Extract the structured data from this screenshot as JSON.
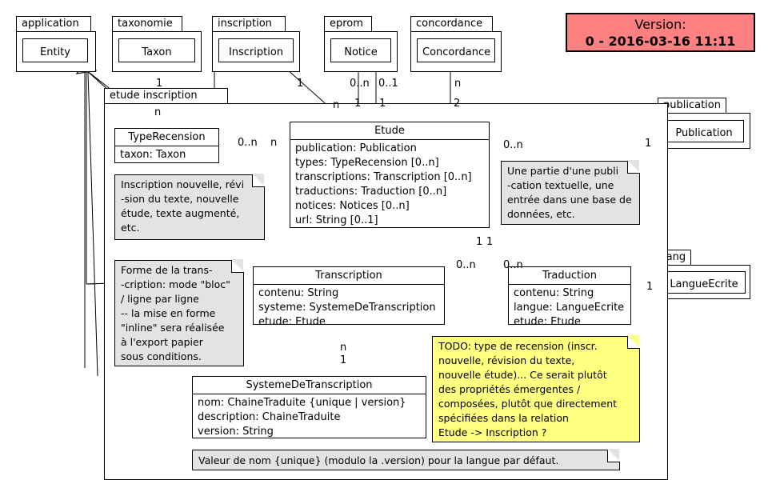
{
  "version_banner": {
    "label": "Version:",
    "value": "0 - 2016-03-16 11:11",
    "bg_color": "#fd8181",
    "border_color": "#000000"
  },
  "packages": [
    {
      "name": "application"
    },
    {
      "name": "taxonomie"
    },
    {
      "name": "inscription"
    },
    {
      "name": "eprom"
    },
    {
      "name": "concordance"
    },
    {
      "name": "publication"
    },
    {
      "name": "etude inscription"
    },
    {
      "name": "lang"
    }
  ],
  "classes": [
    {
      "name": "Entity",
      "attributes": []
    },
    {
      "name": "Taxon",
      "attributes": []
    },
    {
      "name": "Inscription",
      "attributes": []
    },
    {
      "name": "Notice",
      "attributes": []
    },
    {
      "name": "Concordance",
      "attributes": []
    },
    {
      "name": "Publication",
      "attributes": []
    },
    {
      "name": "LangueEcrite",
      "attributes": []
    },
    {
      "name": "TypeRecension",
      "attributes": [
        "taxon: Taxon"
      ]
    },
    {
      "name": "Etude",
      "attributes": [
        "publication: Publication",
        "types: TypeRecension [0..n]",
        "transcriptions: Transcription [0..n]",
        "traductions: Traduction [0..n]",
        "notices: Notices [0..n]",
        "url: String [0..1]"
      ]
    },
    {
      "name": "Transcription",
      "attributes": [
        "contenu: String",
        "systeme: SystemeDeTranscription",
        "etude: Etude"
      ]
    },
    {
      "name": "Traduction",
      "attributes": [
        "contenu: String",
        "langue: LangueEcrite",
        "etude: Etude"
      ]
    },
    {
      "name": "SystemeDeTranscription",
      "attributes": [
        "nom: ChaineTraduite {unique | version}",
        "description: ChaineTraduite",
        "version: String"
      ]
    }
  ],
  "notes": [
    {
      "id": "note-typerecension",
      "color": "#e3e3e3",
      "lines": [
        "Inscription nouvelle, révi",
        "-sion du texte, nouvelle",
        "étude, texte augmenté,",
        "etc."
      ]
    },
    {
      "id": "note-publication",
      "color": "#e3e3e3",
      "lines": [
        "Une partie d'une publi",
        "-cation textuelle, une",
        "entrée dans une base de",
        "données, etc."
      ]
    },
    {
      "id": "note-transcription",
      "color": "#e3e3e3",
      "lines": [
        "Forme de la trans-",
        "-cription: mode \"bloc\"",
        "/ ligne par ligne",
        "-- la mise en forme",
        "\"inline\" sera réalisée",
        "à l'export papier",
        "sous conditions."
      ]
    },
    {
      "id": "note-todo",
      "color": "#ffff80",
      "lines": [
        "TODO: type de recension (inscr.",
        "nouvelle, révision du texte,",
        "nouvelle étude)... Ce serait plutôt",
        "des propriétés émergentes /",
        "composées, plutôt que directement",
        "spécifiées dans la relation",
        "Etude -> Inscription ?"
      ]
    },
    {
      "id": "note-systeme",
      "color": "#e3e3e3",
      "lines": [
        "Valeur de nom {unique} (modulo la .version)  pour la langue par défaut."
      ]
    }
  ],
  "multiplicities": [
    {
      "id": "m-taxon-1",
      "text": "1"
    },
    {
      "id": "m-inscription-1",
      "text": "1"
    },
    {
      "id": "m-notice-0n",
      "text": "0..n"
    },
    {
      "id": "m-notice-01",
      "text": "0..1"
    },
    {
      "id": "m-concordance-n",
      "text": "n"
    },
    {
      "id": "m-typerec-n",
      "text": "n"
    },
    {
      "id": "m-etude-inscr-n",
      "text": "n"
    },
    {
      "id": "m-etude-notice-1a",
      "text": "1"
    },
    {
      "id": "m-etude-notice-1b",
      "text": "1"
    },
    {
      "id": "m-etude-conc-2",
      "text": "2"
    },
    {
      "id": "m-typerec-0n",
      "text": "0..n"
    },
    {
      "id": "m-etude-typerec-n",
      "text": "n"
    },
    {
      "id": "m-etude-pub-0n",
      "text": "0..n"
    },
    {
      "id": "m-publication-1",
      "text": "1"
    },
    {
      "id": "m-etude-trans-1a",
      "text": "1"
    },
    {
      "id": "m-etude-trans-1b",
      "text": "1"
    },
    {
      "id": "m-transcription-0n",
      "text": "0..n"
    },
    {
      "id": "m-traduction-0n",
      "text": "0..n"
    },
    {
      "id": "m-traduction-lang-1",
      "text": "1"
    },
    {
      "id": "m-transcr-sys-n",
      "text": "n"
    },
    {
      "id": "m-transcr-sys-1",
      "text": "1"
    }
  ]
}
